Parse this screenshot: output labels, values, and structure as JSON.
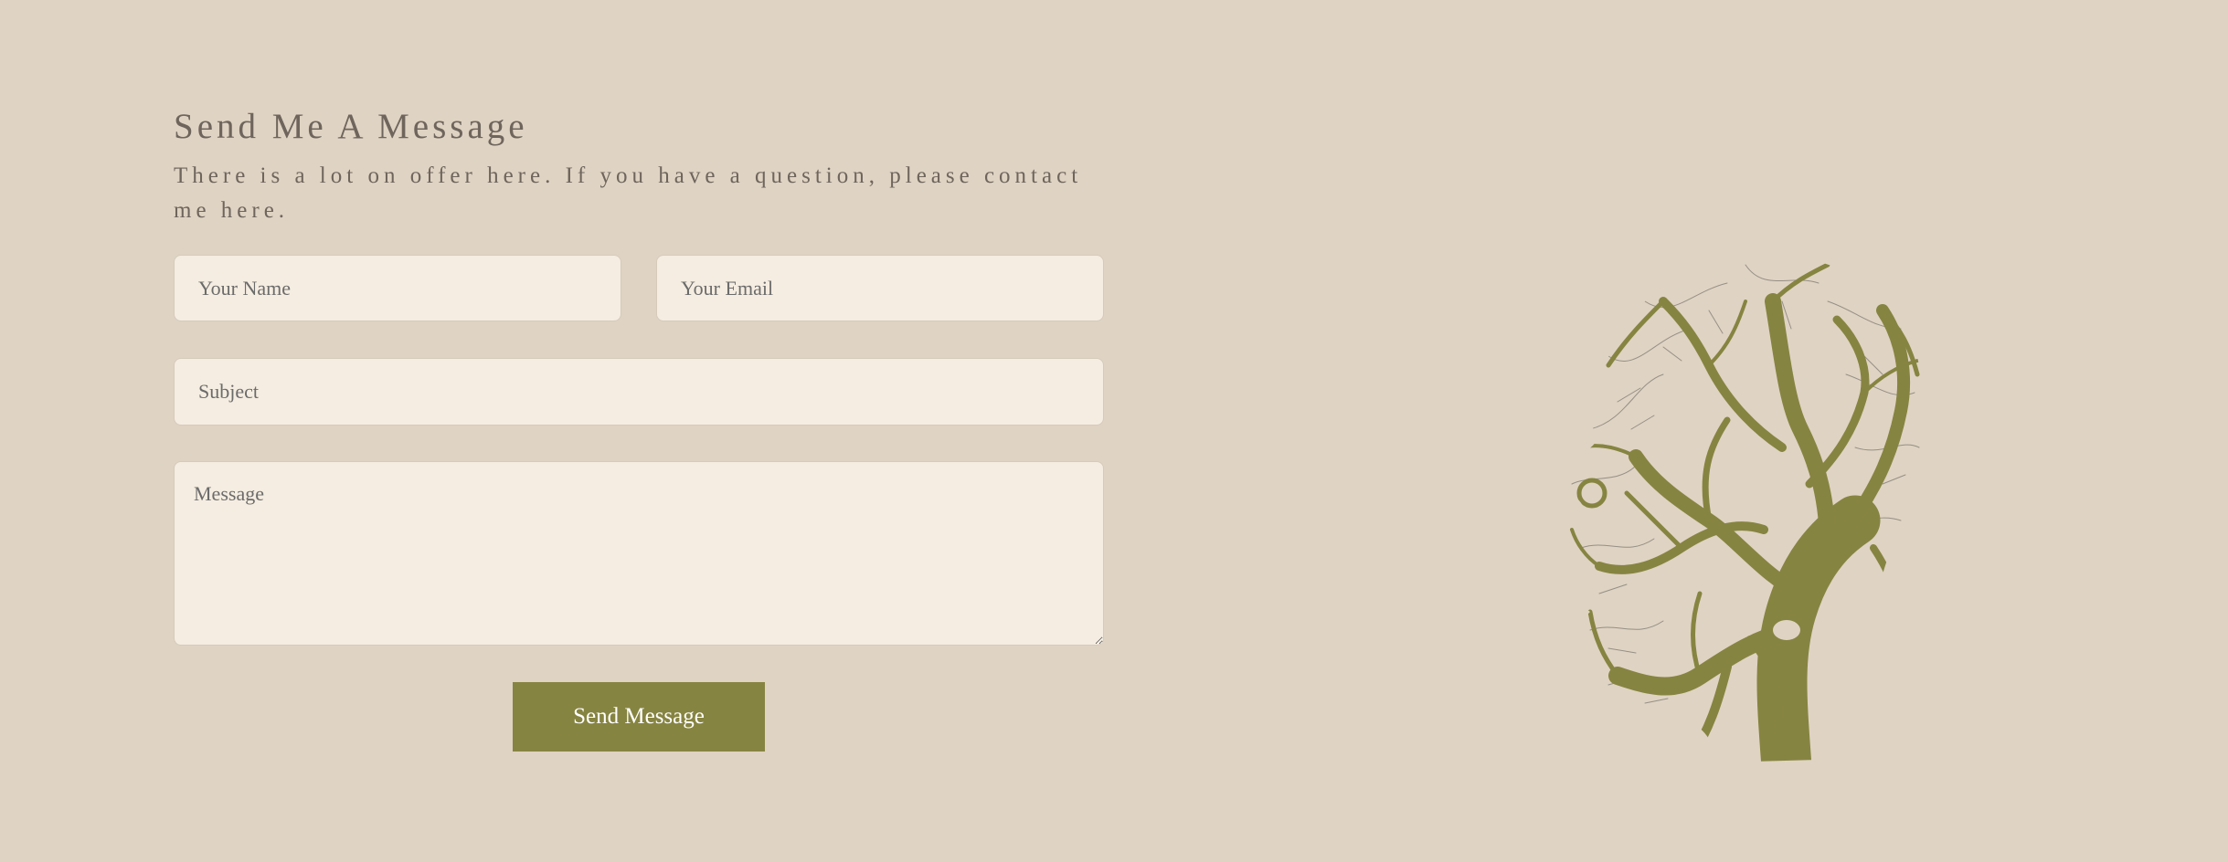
{
  "contact": {
    "title": "Send Me A Message",
    "subtitle": "There is a lot on offer here. If you have a question, please contact me here."
  },
  "form": {
    "name_placeholder": "Your Name",
    "email_placeholder": "Your Email",
    "subject_placeholder": "Subject",
    "message_placeholder": "Message",
    "submit_label": "Send Message"
  },
  "colors": {
    "background": "#dfd3c3",
    "field_background": "#f5ede1",
    "text": "#6f655c",
    "accent": "#868441"
  },
  "illustration": {
    "icon": "tree-head-silhouette-icon"
  }
}
